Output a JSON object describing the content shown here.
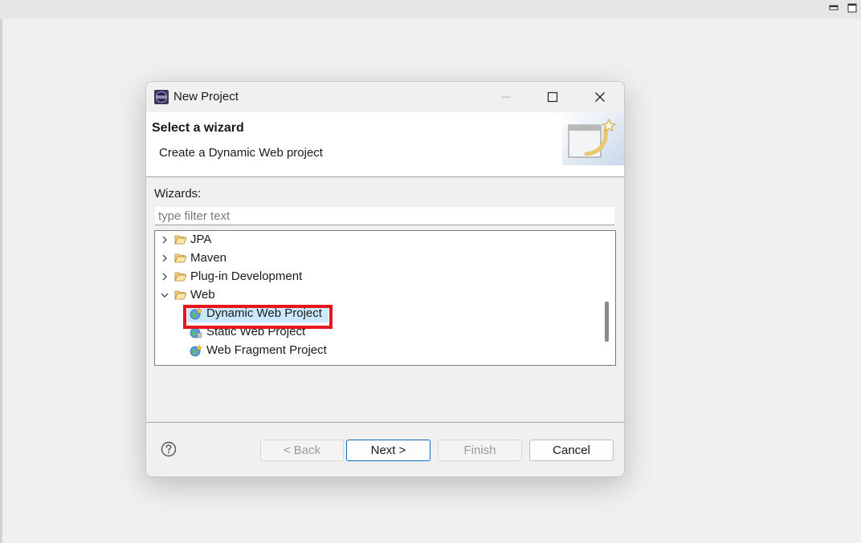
{
  "dialog": {
    "title": "New Project",
    "banner": {
      "heading": "Select a wizard",
      "description": "Create a Dynamic Web project"
    },
    "wizards_label": "Wizards:",
    "filter": {
      "placeholder": "type filter text",
      "value": ""
    },
    "tree": {
      "categories": [
        {
          "label": "JPA",
          "expanded": false
        },
        {
          "label": "Maven",
          "expanded": false
        },
        {
          "label": "Plug-in Development",
          "expanded": false
        },
        {
          "label": "Web",
          "expanded": true
        }
      ],
      "web_children": [
        {
          "label": "Dynamic Web Project",
          "selected": true
        },
        {
          "label": "Static Web Project",
          "selected": false
        },
        {
          "label": "Web Fragment Project",
          "selected": false
        }
      ]
    },
    "buttons": {
      "back": "< Back",
      "next": "Next >",
      "finish": "Finish",
      "cancel": "Cancel"
    }
  },
  "icons": {
    "app": "eclipse-icon",
    "help": "help-icon",
    "folder": "folder-open-icon",
    "web_project": "web-project-icon"
  },
  "colors": {
    "selection": "#cce8ff",
    "highlight_box": "#e8161b",
    "default_button_border": "#0f6cbd"
  }
}
